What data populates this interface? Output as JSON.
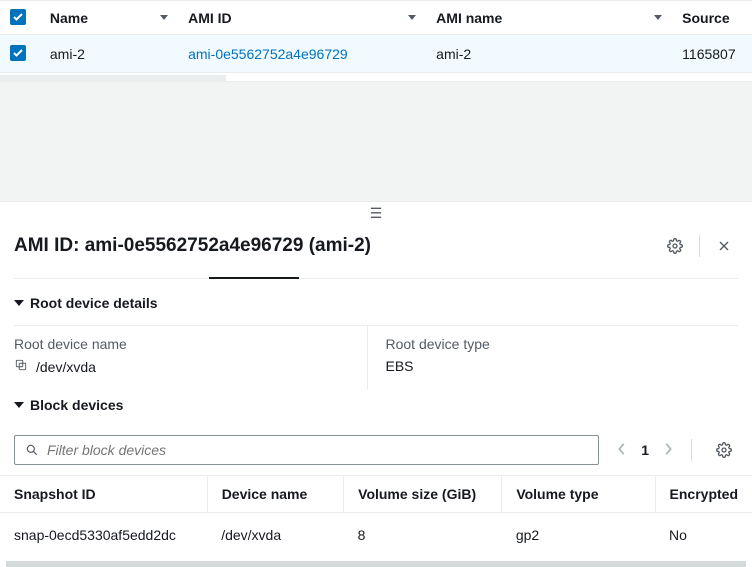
{
  "topTable": {
    "columns": {
      "name": "Name",
      "amiId": "AMI ID",
      "amiName": "AMI name",
      "source": "Source"
    },
    "row": {
      "name": "ami-2",
      "amiId": "ami-0e5562752a4e96729",
      "amiName": "ami-2",
      "source": "1165807"
    }
  },
  "detail": {
    "titlePrefix": "AMI ID: ",
    "titleId": "ami-0e5562752a4e96729",
    "titleSuffix": " (ami-2)",
    "rootDevice": {
      "sectionTitle": "Root device details",
      "nameLabel": "Root device name",
      "nameValue": "/dev/xvda",
      "typeLabel": "Root device type",
      "typeValue": "EBS"
    },
    "blockDevices": {
      "sectionTitle": "Block devices",
      "filterPlaceholder": "Filter block devices",
      "page": "1",
      "columns": {
        "snapshotId": "Snapshot ID",
        "deviceName": "Device name",
        "volumeSize": "Volume size (GiB)",
        "volumeType": "Volume type",
        "encrypted": "Encrypted"
      },
      "row": {
        "snapshotId": "snap-0ecd5330af5edd2dc",
        "deviceName": "/dev/xvda",
        "volumeSize": "8",
        "volumeType": "gp2",
        "encrypted": "No"
      }
    }
  }
}
